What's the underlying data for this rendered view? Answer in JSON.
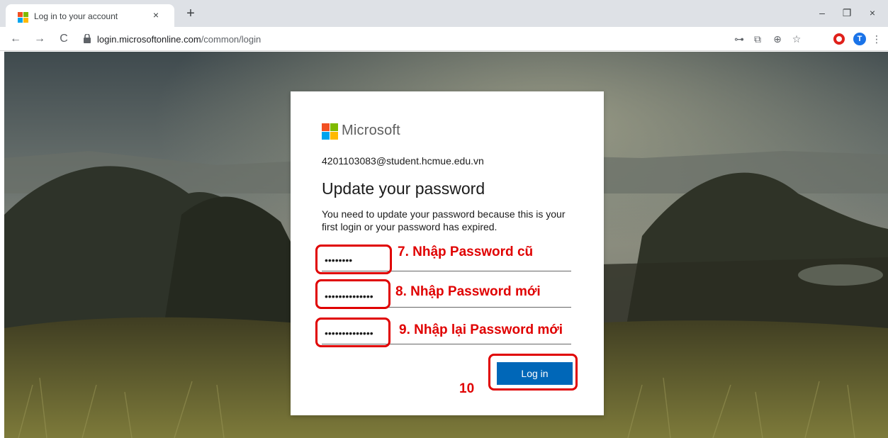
{
  "tab": {
    "title": "Log in to your account",
    "close": "×",
    "new_tab": "+"
  },
  "window": {
    "minimize": "–",
    "restore": "❐",
    "close": "×"
  },
  "nav": {
    "back": "←",
    "forward": "→",
    "reload": "C"
  },
  "address": {
    "host": "login.microsoftonline.com",
    "path": "/common/login"
  },
  "toolbar": {
    "key": "⊶",
    "translate": "⧉",
    "zoom": "⊕",
    "star": "☆",
    "profile_initial": "T",
    "menu": "⋮"
  },
  "card": {
    "brand": "Microsoft",
    "account": "4201103083@student.hcmue.edu.vn",
    "heading": "Update your password",
    "description": "You need to update your password because this is your first login or your password has expired.",
    "old_password_mask": "••••••••",
    "new_password_mask": "••••••••••••••",
    "confirm_password_mask": "••••••••••••••",
    "login_button": "Log in"
  },
  "annotations": {
    "step7": "7. Nhập Password cũ",
    "step8": "8. Nhập Password mới",
    "step9": "9. Nhập lại Password mới",
    "step10": "10",
    "color": "#e00000"
  },
  "colors": {
    "ms_red": "#f25022",
    "ms_green": "#7fba00",
    "ms_blue": "#00a4ef",
    "ms_yellow": "#ffb900",
    "button_blue": "#0067b8"
  }
}
